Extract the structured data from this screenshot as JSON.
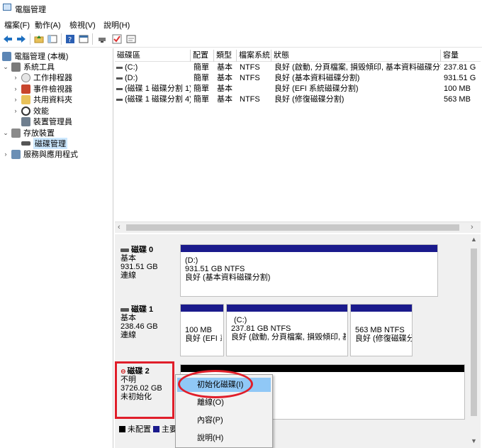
{
  "window": {
    "title": "電腦管理"
  },
  "menu": [
    "檔案(F)",
    "動作(A)",
    "檢視(V)",
    "說明(H)"
  ],
  "toolbar": {
    "icons": [
      "back-icon",
      "forward-icon",
      "up-folder-icon",
      "show-tree-icon",
      "help-icon",
      "properties-icon",
      "connect-icon",
      "check-icon",
      "export-icon"
    ]
  },
  "tree": {
    "items": [
      {
        "label": "電腦管理 (本機)",
        "icon": "computer-icon",
        "arrow": ""
      },
      {
        "label": "系統工具",
        "icon": "tools-icon",
        "arrow": "⌄"
      },
      {
        "label": "工作排程器",
        "icon": "clock-icon",
        "arrow": "›"
      },
      {
        "label": "事件檢視器",
        "icon": "event-icon",
        "arrow": "›"
      },
      {
        "label": "共用資料夾",
        "icon": "shared-folder-icon",
        "arrow": "›"
      },
      {
        "label": "效能",
        "icon": "performance-icon",
        "arrow": "›"
      },
      {
        "label": "裝置管理員",
        "icon": "device-icon",
        "arrow": ""
      },
      {
        "label": "存放裝置",
        "icon": "storage-icon",
        "arrow": "⌄"
      },
      {
        "label": "磁碟管理",
        "icon": "disk-icon",
        "arrow": ""
      },
      {
        "label": "服務與應用程式",
        "icon": "services-icon",
        "arrow": "›"
      }
    ]
  },
  "volumes": {
    "headers": [
      "磁碟區",
      "配置",
      "類型",
      "檔案系統",
      "狀態",
      "容量"
    ],
    "rows": [
      [
        "(C:)",
        "簡單",
        "基本",
        "NTFS",
        "良好 (啟動, 分頁檔案, 損毀傾印, 基本資料磁碟分割)",
        "237.81 G"
      ],
      [
        "(D:)",
        "簡單",
        "基本",
        "NTFS",
        "良好 (基本資料磁碟分割)",
        "931.51 G"
      ],
      [
        "(磁碟 1 磁碟分割 1)",
        "簡單",
        "基本",
        "",
        "良好 (EFI 系統磁碟分割)",
        "100 MB"
      ],
      [
        "(磁碟 1 磁碟分割 4)",
        "簡單",
        "基本",
        "NTFS",
        "良好 (修復磁碟分割)",
        "563 MB"
      ]
    ]
  },
  "disks": [
    {
      "name": "磁碟 0",
      "type": "基本",
      "size": "931.51 GB",
      "status": "連線",
      "parts": [
        {
          "label": "(D:)",
          "size": "931.51 GB NTFS",
          "status": "良好 (基本資料磁碟分割)"
        }
      ]
    },
    {
      "name": "磁碟 1",
      "type": "基本",
      "size": "238.46 GB",
      "status": "連線",
      "parts": [
        {
          "label": "",
          "size": "100 MB",
          "status": "良好 (EFI 系"
        },
        {
          "label": "(C:)",
          "size": "237.81 GB NTFS",
          "status": "良好 (啟動, 分頁檔案, 損毀傾印, 基²"
        },
        {
          "label": "",
          "size": "563 MB NTFS",
          "status": "良好 (修復磁碟分"
        }
      ]
    },
    {
      "name": "磁碟 2",
      "type": "不明",
      "size": "3726.02 GB",
      "status": "未初始化"
    }
  ],
  "legend": {
    "unallocated": "未配置",
    "primary": "主要"
  },
  "context_menu": {
    "items": [
      "初始化磁碟(I)",
      "離線(O)",
      "內容(P)",
      "說明(H)"
    ]
  },
  "colors": {
    "highlight_red": "#e01e2a",
    "partition_bar": "#1a1a8c",
    "menu_highlight": "#90c8f6",
    "selection": "#cce8ff"
  }
}
